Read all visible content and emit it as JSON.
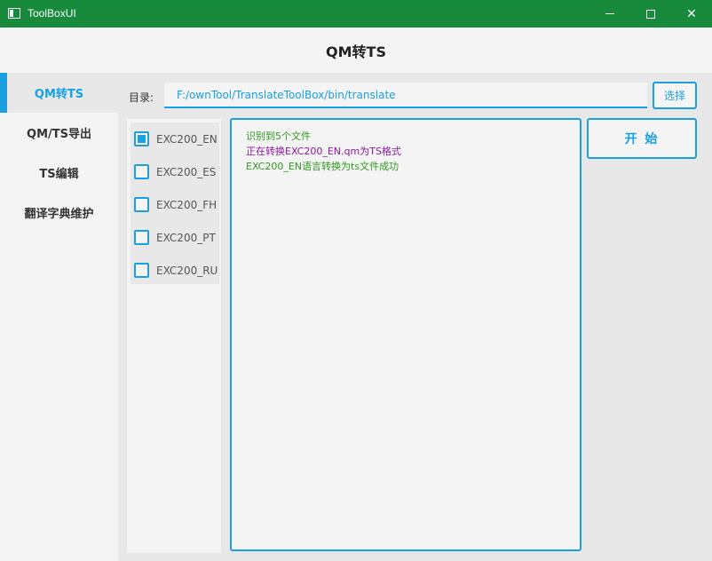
{
  "window": {
    "title": "ToolBoxUI",
    "controls": {
      "minimize": "minimize-icon",
      "maximize": "maximize-icon",
      "close": "close-icon"
    }
  },
  "header": {
    "title": "QM转TS"
  },
  "sidebar": {
    "items": [
      {
        "label": "QM转TS",
        "active": true
      },
      {
        "label": "QM/TS导出",
        "active": false
      },
      {
        "label": "TS编辑",
        "active": false
      },
      {
        "label": "翻译字典维护",
        "active": false
      }
    ]
  },
  "directory": {
    "label": "目录:",
    "value": "F:/ownTool/TranslateToolBox/bin/translate",
    "choose_label": "选择"
  },
  "files": [
    {
      "name": "EXC200_EN",
      "checked": true
    },
    {
      "name": "EXC200_ES",
      "checked": false
    },
    {
      "name": "EXC200_FH",
      "checked": false
    },
    {
      "name": "EXC200_PT",
      "checked": false
    },
    {
      "name": "EXC200_RU",
      "checked": false
    }
  ],
  "log": [
    {
      "text": "识别到5个文件",
      "color": "#2e9a1c"
    },
    {
      "text": "正在转换EXC200_EN.qm为TS格式",
      "color": "#8a1a9c"
    },
    {
      "text": "EXC200_EN语言转换为ts文件成功",
      "color": "#2e9a1c"
    }
  ],
  "start_label": "开 始",
  "colors": {
    "accent": "#1a9fe0",
    "titlebar": "#178a3c"
  }
}
